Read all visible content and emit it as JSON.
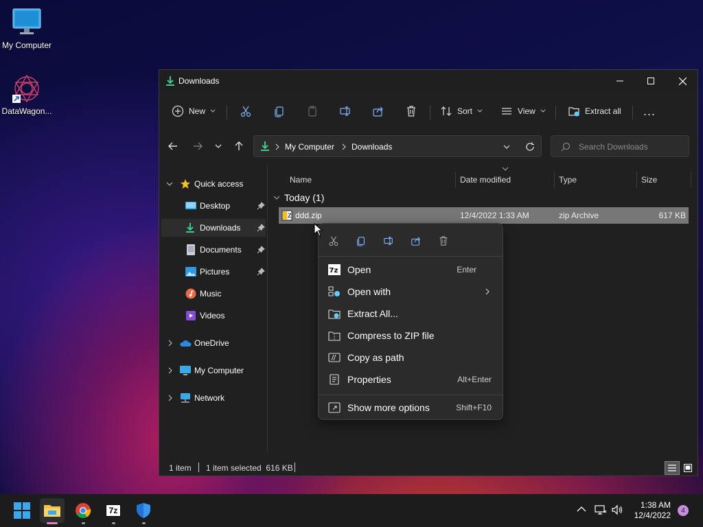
{
  "desktop": {
    "icons": [
      {
        "label": "My Computer"
      },
      {
        "label": "DataWagon..."
      }
    ]
  },
  "window": {
    "title": "Downloads",
    "toolbar": {
      "new_label": "New",
      "sort_label": "Sort",
      "view_label": "View",
      "extract_label": "Extract all",
      "more_label": "..."
    },
    "breadcrumb": [
      "My Computer",
      "Downloads"
    ],
    "search_placeholder": "Search Downloads",
    "sidebar": {
      "quick_access": "Quick access",
      "items": [
        {
          "label": "Desktop",
          "pinned": true
        },
        {
          "label": "Downloads",
          "pinned": true,
          "active": true
        },
        {
          "label": "Documents",
          "pinned": true
        },
        {
          "label": "Pictures",
          "pinned": true
        },
        {
          "label": "Music"
        },
        {
          "label": "Videos"
        }
      ],
      "roots": [
        {
          "label": "OneDrive"
        },
        {
          "label": "My Computer"
        },
        {
          "label": "Network"
        }
      ]
    },
    "columns": [
      "Name",
      "Date modified",
      "Type",
      "Size"
    ],
    "group_label": "Today (1)",
    "files": [
      {
        "name": "ddd.zip",
        "date": "12/4/2022 1:33 AM",
        "type": "zip Archive",
        "size": "617 KB"
      }
    ],
    "status": {
      "count": "1 item",
      "selection": "1 item selected  616 KB"
    }
  },
  "context_menu": {
    "items": [
      {
        "label": "Open",
        "shortcut": "Enter"
      },
      {
        "label": "Open with",
        "shortcut": ""
      },
      {
        "label": "Extract All...",
        "shortcut": ""
      },
      {
        "label": "Compress to ZIP file",
        "shortcut": ""
      },
      {
        "label": "Copy as path",
        "shortcut": ""
      },
      {
        "label": "Properties",
        "shortcut": "Alt+Enter"
      }
    ],
    "more": {
      "label": "Show more options",
      "shortcut": "Shift+F10"
    }
  },
  "taskbar": {
    "time": "1:38 AM",
    "date": "12/4/2022",
    "notification_count": "4",
    "app_7zip_label": "7z"
  },
  "colors": {
    "accent": "#60cdff",
    "window_bg": "#202020",
    "selected_row": "#777777"
  }
}
